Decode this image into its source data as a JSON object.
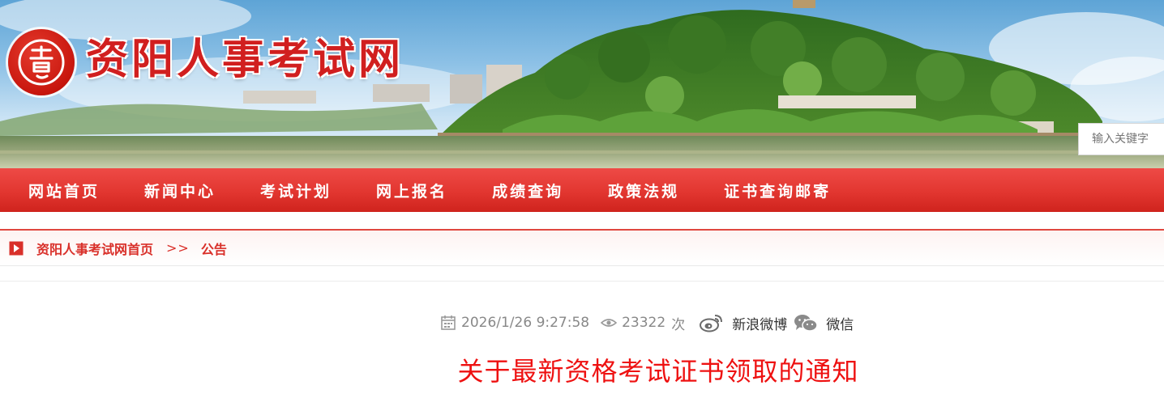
{
  "site": {
    "title": "资阳人事考试网",
    "logo_icon": "seal-logo-icon"
  },
  "search": {
    "placeholder": "输入关键字"
  },
  "nav": {
    "items": [
      {
        "label": "网站首页"
      },
      {
        "label": "新闻中心"
      },
      {
        "label": "考试计划"
      },
      {
        "label": "网上报名"
      },
      {
        "label": "成绩查询"
      },
      {
        "label": "政策法规"
      },
      {
        "label": "证书查询邮寄"
      }
    ]
  },
  "breadcrumb": {
    "home_label": "资阳人事考试网首页",
    "separator": ">>",
    "current_label": "公告",
    "icon": "play-square-icon"
  },
  "article": {
    "datetime": "2026/1/26 9:27:58",
    "views": "23322",
    "views_unit": "次",
    "share_weibo_label": "新浪微博",
    "share_wechat_label": "微信",
    "title": "关于最新资格考试证书领取的通知"
  },
  "colors": {
    "brand_red": "#d11f1f",
    "nav_red": "#e23630",
    "title_red": "#ee1111",
    "muted_text": "#888888"
  }
}
